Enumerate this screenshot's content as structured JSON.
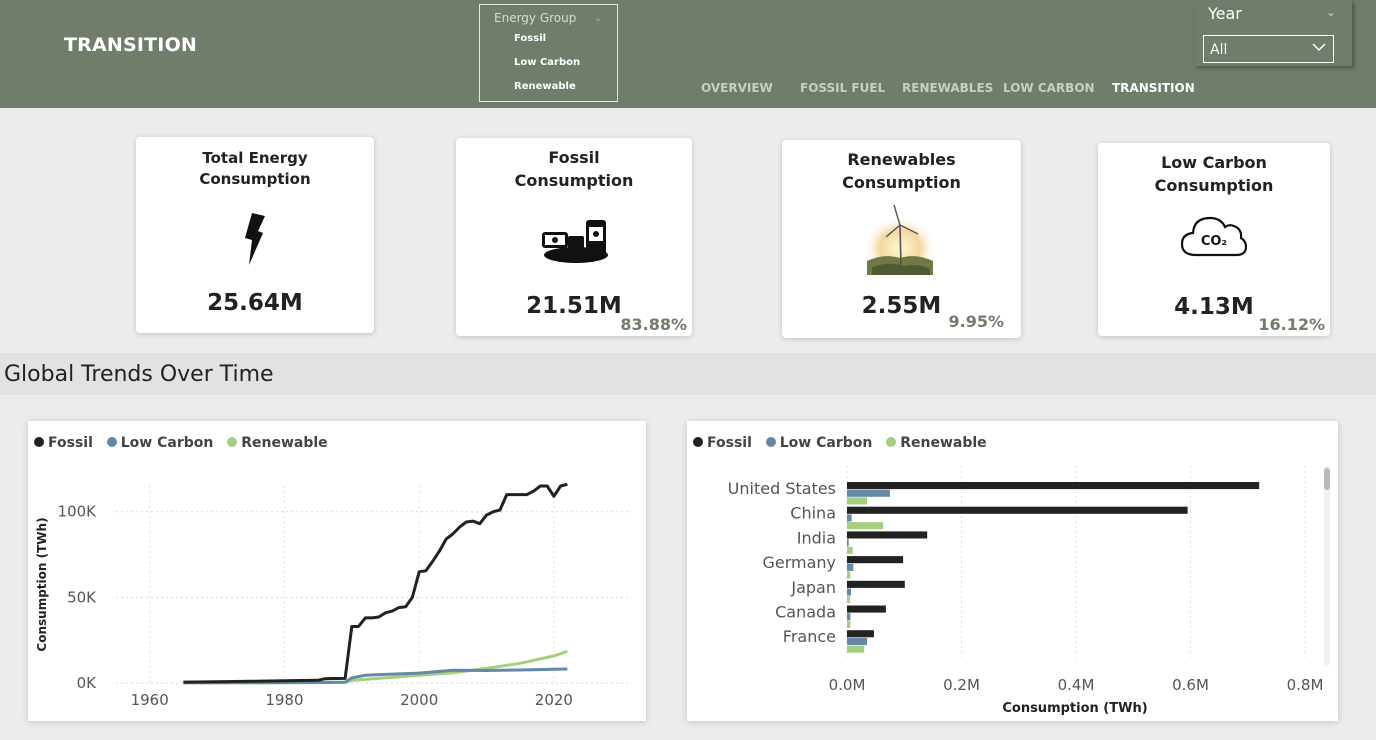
{
  "header": {
    "title": "TRANSITION",
    "slicer": {
      "title": "Energy Group",
      "items": [
        "Fossil",
        "Low Carbon",
        "Renewable"
      ]
    },
    "nav": [
      "OVERVIEW",
      "FOSSIL FUEL",
      "RENEWABLES",
      "LOW CARBON",
      "TRANSITION"
    ],
    "active_tab": "TRANSITION",
    "year": {
      "label": "Year",
      "value": "All"
    }
  },
  "cards": [
    {
      "title_line1": "Total Energy",
      "title_line2": "Consumption",
      "value": "25.64M",
      "pct": "",
      "icon": "lightning-bolt-icon"
    },
    {
      "title_line1": "Fossil",
      "title_line2": "Consumption",
      "value": "21.51M",
      "pct": "83.88%",
      "icon": "oil-barrels-icon"
    },
    {
      "title_line1": "Renewables",
      "title_line2": "Consumption",
      "value": "2.55M",
      "pct": "9.95%",
      "icon": "wind-turbine-icon"
    },
    {
      "title_line1": "Low Carbon",
      "title_line2": "Consumption",
      "value": "4.13M",
      "pct": "16.12%",
      "icon": "co2-cloud-icon",
      "icon_text": "CO₂"
    }
  ],
  "section": {
    "title": "Global Trends Over Time"
  },
  "colors": {
    "fossil": "#222222",
    "low_carbon": "#6389a6",
    "renewable": "#a4cf7e",
    "header": "#717d6b"
  },
  "chart_data": [
    {
      "type": "line",
      "title": "",
      "xlabel": "",
      "ylabel": "Consumption (TWh)",
      "xlim": [
        1955,
        2031
      ],
      "ylim": [
        0,
        115000
      ],
      "yticks": [
        0,
        50000,
        100000
      ],
      "yticklabels": [
        "0K",
        "50K",
        "100K"
      ],
      "xticks": [
        1960,
        1980,
        2000,
        2020
      ],
      "legend": "top-left",
      "series": [
        {
          "name": "Fossil",
          "x": [
            1965,
            1970,
            1975,
            1980,
            1985,
            1986,
            1987,
            1988,
            1989,
            1990,
            1991,
            1992,
            1993,
            1994,
            1995,
            1996,
            1997,
            1998,
            1999,
            2000,
            2001,
            2002,
            2003,
            2004,
            2005,
            2006,
            2007,
            2008,
            2009,
            2010,
            2011,
            2012,
            2013,
            2014,
            2015,
            2016,
            2017,
            2018,
            2019,
            2020,
            2021,
            2022
          ],
          "y": [
            500,
            700,
            1000,
            1300,
            1600,
            2500,
            2600,
            2600,
            2700,
            33000,
            33000,
            38000,
            38000,
            38500,
            41000,
            42000,
            44000,
            44500,
            50000,
            65000,
            65500,
            71000,
            77000,
            84000,
            87000,
            91000,
            94000,
            94500,
            93000,
            98000,
            100000,
            101000,
            110000,
            110000,
            110000,
            110000,
            112000,
            115000,
            115000,
            109000,
            115000,
            116000
          ]
        },
        {
          "name": "Low Carbon",
          "x": [
            1965,
            1975,
            1985,
            1989,
            1990,
            1992,
            1995,
            2000,
            2005,
            2010,
            2015,
            2020,
            2022
          ],
          "y": [
            100,
            200,
            300,
            400,
            3000,
            4500,
            5000,
            5800,
            7500,
            7300,
            7600,
            8000,
            8200
          ]
        },
        {
          "name": "Renewable",
          "x": [
            1965,
            1975,
            1985,
            1989,
            1990,
            1995,
            2000,
            2005,
            2010,
            2015,
            2020,
            2022
          ],
          "y": [
            100,
            200,
            300,
            400,
            1500,
            3000,
            4500,
            6000,
            8500,
            11500,
            15800,
            18500
          ]
        }
      ]
    },
    {
      "type": "bar",
      "orientation": "horizontal",
      "title": "",
      "xlabel": "Consumption (TWh)",
      "ylabel": "",
      "xlim": [
        0,
        0.8
      ],
      "xticks": [
        0,
        0.2,
        0.4,
        0.6,
        0.8
      ],
      "xticklabels": [
        "0.0M",
        "0.2M",
        "0.4M",
        "0.6M",
        "0.8M"
      ],
      "legend": "top-left",
      "categories": [
        "United States",
        "China",
        "India",
        "Germany",
        "Japan",
        "Canada",
        "France"
      ],
      "series": [
        {
          "name": "Fossil",
          "values": [
            0.72,
            0.595,
            0.14,
            0.098,
            0.101,
            0.068,
            0.047
          ]
        },
        {
          "name": "Low Carbon",
          "values": [
            0.075,
            0.008,
            0.003,
            0.011,
            0.007,
            0.006,
            0.035
          ]
        },
        {
          "name": "Renewable",
          "values": [
            0.035,
            0.063,
            0.01,
            0.006,
            0.005,
            0.006,
            0.03
          ]
        }
      ]
    }
  ]
}
